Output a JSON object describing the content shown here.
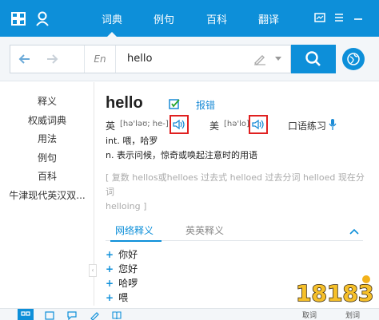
{
  "header": {
    "tabs": [
      {
        "label": "词典",
        "active": true
      },
      {
        "label": "例句",
        "active": false
      },
      {
        "label": "百科",
        "active": false
      },
      {
        "label": "翻译",
        "active": false
      }
    ]
  },
  "search": {
    "lang": "En",
    "query": "hello"
  },
  "sidebar": {
    "items": [
      {
        "label": "释义"
      },
      {
        "label": "权威词典"
      },
      {
        "label": "用法"
      },
      {
        "label": "例句"
      },
      {
        "label": "百科"
      },
      {
        "label": "牛津现代英汉双..."
      }
    ]
  },
  "entry": {
    "word": "hello",
    "report_label": "报错",
    "uk_label": "英",
    "uk_phonetic": "[hə'ləʊ; he-]",
    "us_label": "美",
    "us_phonetic": "[hə'lo]",
    "oral_label": "口语练习",
    "definitions": [
      "int. 喂，哈罗",
      "n. 表示问候，惊奇或唤起注意时的用语"
    ],
    "forms_line1": "[ 复数 hellos或helloes 过去式 helloed 过去分词 helloed 现在分词",
    "forms_line2": "helloing ]"
  },
  "subtabs": {
    "web": "网络释义",
    "en_en": "英英释义"
  },
  "web_meanings": [
    "你好",
    "您好",
    "哈啰",
    "喂"
  ],
  "bottom": {
    "item1": "取词",
    "item2": "划词"
  },
  "watermark": "18183",
  "colors": {
    "brand_blue": "#0d8fd9",
    "highlight_red": "#e02020"
  }
}
